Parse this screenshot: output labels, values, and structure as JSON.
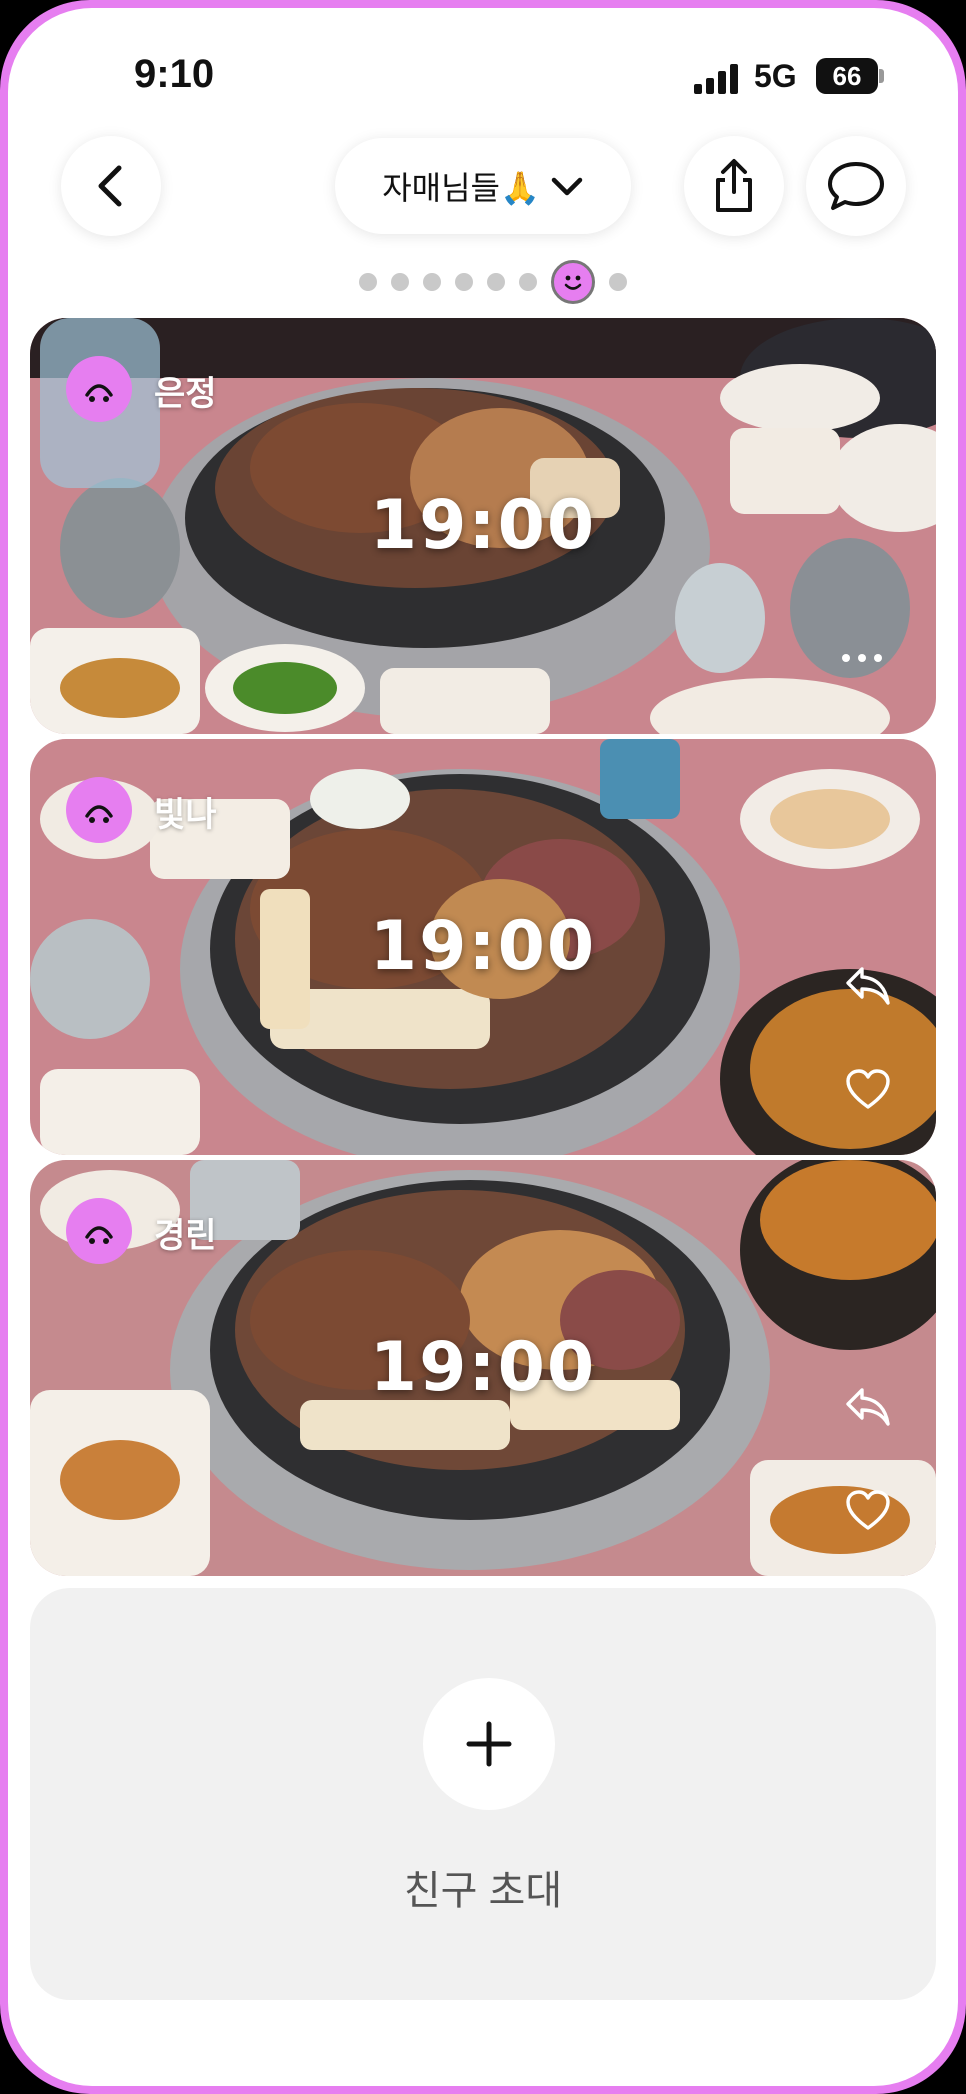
{
  "status_bar": {
    "time": "9:10",
    "network": "5G",
    "battery": "66"
  },
  "header": {
    "group_name": "자매님들🙏",
    "back_icon": "chevron-left-icon",
    "share_icon": "share-icon",
    "chat_icon": "chat-bubble-icon"
  },
  "pager": {
    "count": 8,
    "active_index": 6
  },
  "cards": [
    {
      "name": "은정",
      "time": "19:00"
    },
    {
      "name": "빛나",
      "time": "19:00"
    },
    {
      "name": "경린",
      "time": "19:00"
    }
  ],
  "invite": {
    "label": "친구 초대",
    "icon": "plus-icon"
  },
  "colors": {
    "accent": "#e67ef0",
    "background": "#ffffff",
    "invite_bg": "#f1f1f1"
  }
}
